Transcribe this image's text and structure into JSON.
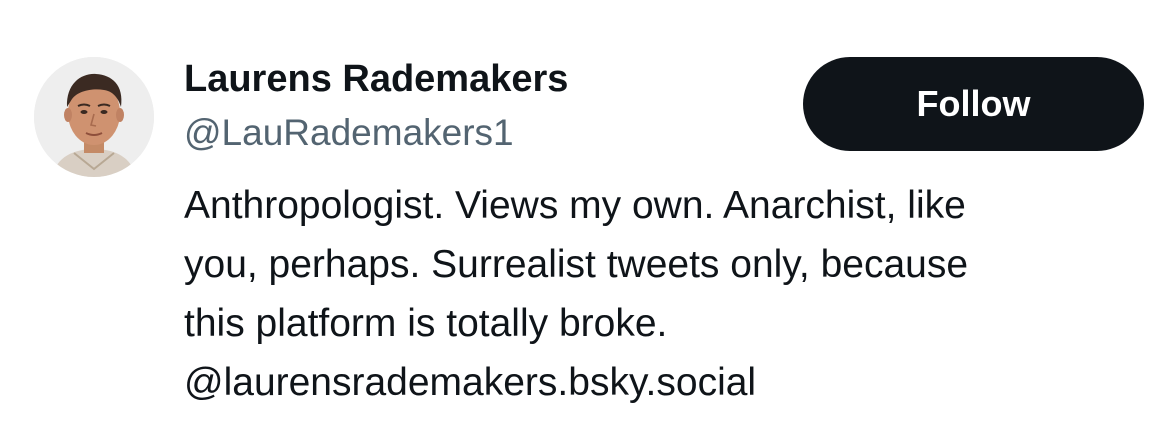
{
  "profile": {
    "display_name": "Laurens Rademakers",
    "handle": "@LauRademakers1",
    "avatar_icon": "user-avatar-photo",
    "follow_label": "Follow",
    "bio_lines": [
      "Anthropologist. Views my own. Anarchist, like",
      "you, perhaps. Surrealist tweets only, because",
      "this platform is totally broke.",
      "@laurensrademakers.bsky.social"
    ]
  },
  "colors": {
    "text_primary": "#0f1419",
    "text_secondary": "#536471",
    "button_bg": "#0f1419",
    "button_text": "#ffffff",
    "background": "#ffffff"
  }
}
